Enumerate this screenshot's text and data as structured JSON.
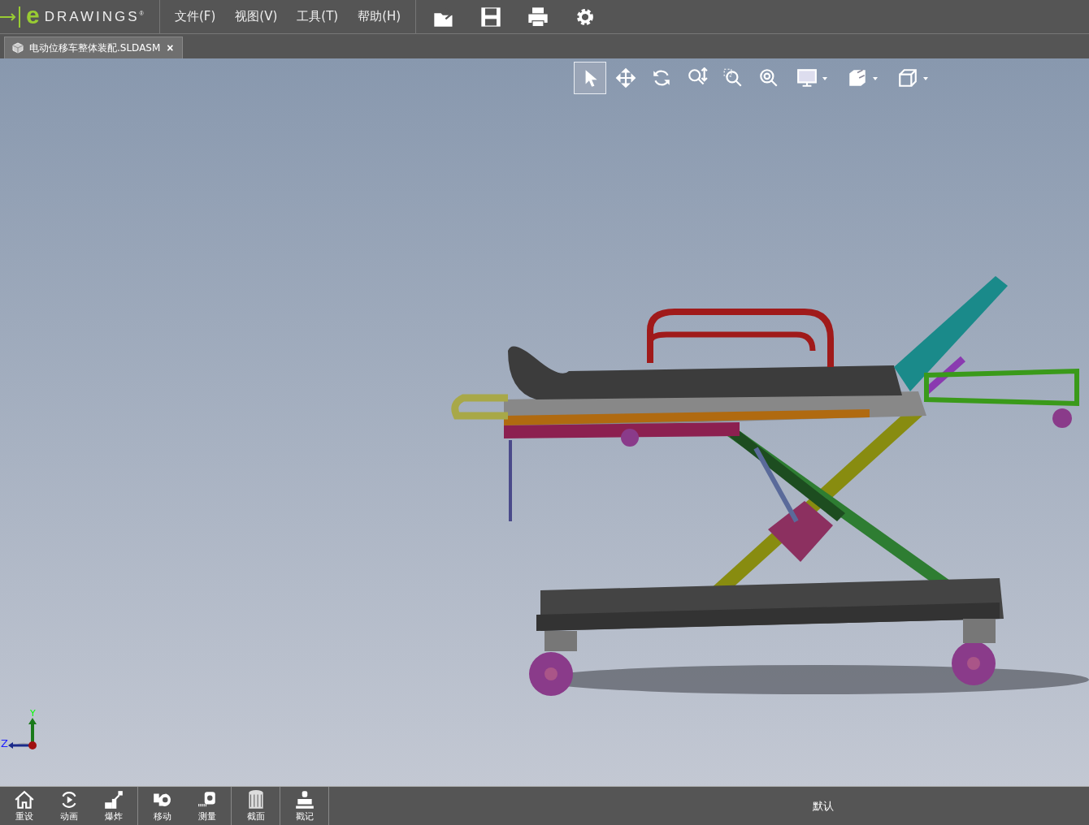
{
  "app": {
    "logo_letter": "e",
    "logo_text": "DRAWINGS$^{®}$"
  },
  "menu": [
    {
      "label": "文件(F)"
    },
    {
      "label": "视图(V)"
    },
    {
      "label": "工具(T)"
    },
    {
      "label": "帮助(H)"
    }
  ],
  "file_tools": [
    {
      "kind": "open"
    },
    {
      "kind": "save"
    },
    {
      "kind": "print"
    },
    {
      "kind": "settings"
    }
  ],
  "document_tab": {
    "title": "电动位移车整体装配.SLDASM",
    "close": "×",
    "selected": true
  },
  "view_toolbar": [
    {
      "kind": "select",
      "selected": true,
      "dropdown": false
    },
    {
      "kind": "pan",
      "selected": false,
      "dropdown": false
    },
    {
      "kind": "rotate",
      "selected": false,
      "dropdown": false
    },
    {
      "kind": "zoom",
      "selected": false,
      "dropdown": false
    },
    {
      "kind": "zoom-area",
      "selected": false,
      "dropdown": false
    },
    {
      "kind": "zoom-fit",
      "selected": false,
      "dropdown": false
    },
    {
      "kind": "display",
      "selected": false,
      "dropdown": true
    },
    {
      "kind": "views",
      "selected": false,
      "dropdown": true
    },
    {
      "kind": "cube",
      "selected": false,
      "dropdown": true
    }
  ],
  "triad": {
    "y": "Y",
    "z": "Z"
  },
  "bottom_tools": [
    {
      "tools": [
        {
          "kind": "home",
          "label": "重设"
        },
        {
          "kind": "animate",
          "label": "动画"
        },
        {
          "kind": "explode",
          "label": "爆炸"
        }
      ]
    },
    {
      "tools": [
        {
          "kind": "move",
          "label": "移动"
        },
        {
          "kind": "measure",
          "label": "测量"
        }
      ]
    },
    {
      "tools": [
        {
          "kind": "section",
          "label": "截面"
        }
      ]
    },
    {
      "tools": [
        {
          "kind": "stamp",
          "label": "戳记"
        }
      ]
    }
  ],
  "configuration": "默认"
}
